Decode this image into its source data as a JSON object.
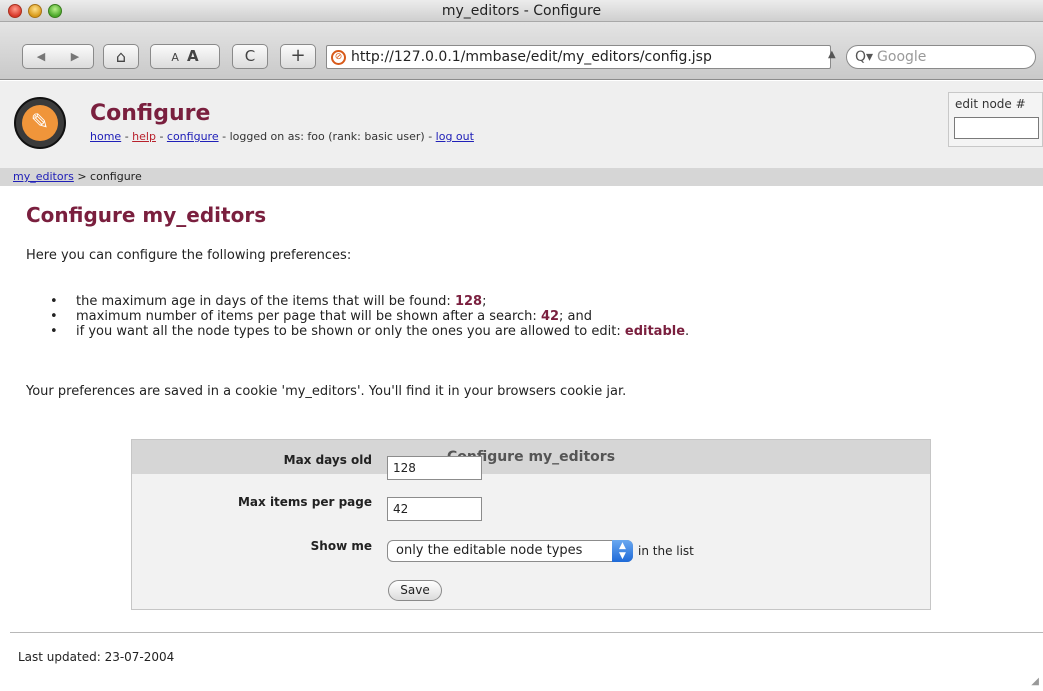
{
  "window": {
    "title": "my_editors - Configure"
  },
  "toolbar": {
    "back_glyph": "◀",
    "forward_glyph": "▶",
    "home_glyph": "⌂",
    "text_small": "A",
    "text_large": "A",
    "reload_glyph": "C",
    "add_glyph": "+",
    "url": "http://127.0.0.1/mmbase/edit/my_editors/config.jsp",
    "search_placeholder": "Google",
    "search_glyph": "Q▾"
  },
  "header": {
    "title": "Configure",
    "nav": {
      "home": "home",
      "help": "help",
      "configure": "configure",
      "sep": "-",
      "logged_on": "logged on as: foo (rank: basic user)",
      "logout": "log out"
    },
    "edit_node_label": "edit node #",
    "edit_node_value": ""
  },
  "breadcrumb": {
    "link": "my_editors",
    "rest": "> configure"
  },
  "content": {
    "title": "Configure my_editors",
    "intro": "Here you can configure the following preferences:",
    "prefs": [
      {
        "text": "the maximum age in days of the items that will be found: ",
        "value": "128",
        "suffix": ";"
      },
      {
        "text": "maximum number of items per page that will be shown after a search: ",
        "value": "42",
        "suffix": "; and"
      },
      {
        "text": "if you want all the node types to be shown or only the ones you are allowed to edit: ",
        "value": "editable",
        "suffix": "."
      }
    ],
    "saved_note": "Your preferences are saved in a cookie 'my_editors'. You'll find it in your browsers cookie jar."
  },
  "form": {
    "heading": "Configure my_editors",
    "max_days_label": "Max days old",
    "max_days_value": "128",
    "max_items_label": "Max items per page",
    "max_items_value": "42",
    "show_me_label": "Show me",
    "show_me_selected": "only the editable node types",
    "show_me_after": "in the list",
    "save_label": "Save"
  },
  "footer": {
    "last_updated": "Last updated: 23-07-2004"
  },
  "colors": {
    "heading": "#7a1f3e",
    "link": "#2020b8",
    "help_link": "#b8202b",
    "logo_orange": "#f0953a"
  }
}
